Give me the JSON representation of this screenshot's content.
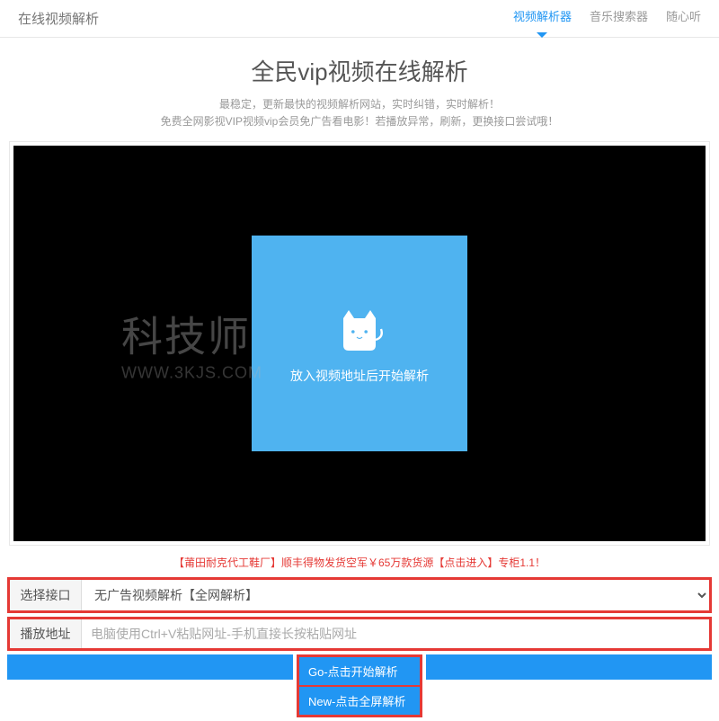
{
  "header": {
    "brand": "在线视频解析",
    "nav": [
      {
        "label": "视频解析器",
        "active": true
      },
      {
        "label": "音乐搜索器",
        "active": false
      },
      {
        "label": "随心听",
        "active": false
      }
    ]
  },
  "title": "全民vip视频在线解析",
  "subtitle_line1": "最稳定，更新最快的视频解析网站，实时纠错，实时解析！",
  "subtitle_line2": "免费全网影视VIP视频vip会员免广告看电影！若播放异常，刷新，更换接口尝试哦！",
  "player": {
    "placeholder_text": "放入视频地址后开始解析"
  },
  "watermark": {
    "main": "科技师",
    "sub": "WWW.3KJS.COM"
  },
  "promo": "【莆田耐克代工鞋厂】顺丰得物发货空军￥65万款货源【点击进入】专柜1.1！",
  "form": {
    "interface_label": "选择接口",
    "interface_selected": "无广告视频解析【全网解析】",
    "url_label": "播放地址",
    "url_placeholder": "电脑使用Ctrl+V粘贴网址-手机直接长按粘贴网址"
  },
  "buttons": {
    "go": "Go-点击开始解析",
    "new": "New-点击全屏解析"
  }
}
